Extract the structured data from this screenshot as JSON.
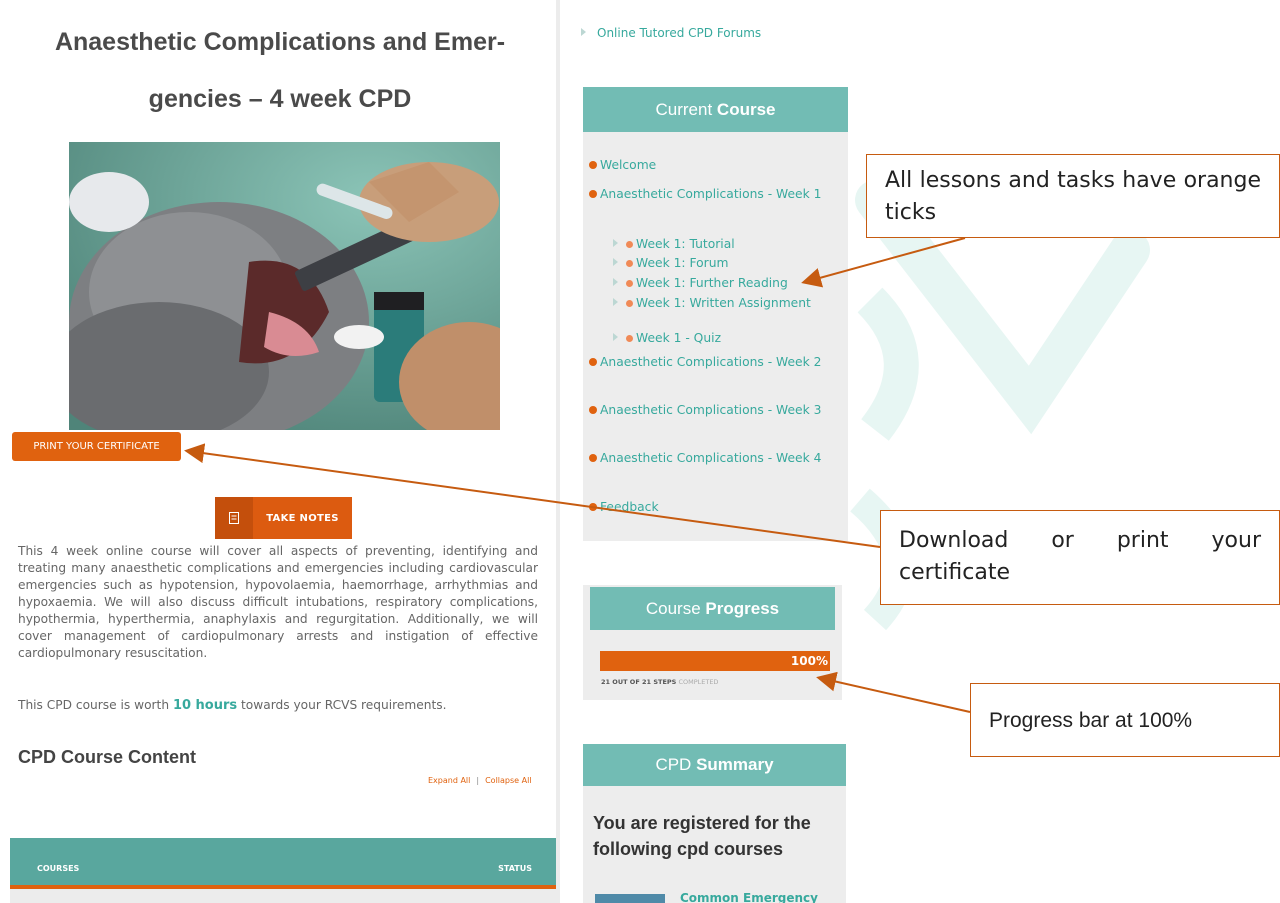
{
  "course": {
    "title_line1": "Anaesthetic Complications and Emer-",
    "title_line2": "gencies – 4 week CPD",
    "print_certificate": "PRINT YOUR CERTIFICATE",
    "take_notes": "TAKE NOTES",
    "description": "This 4 week online course will cover all aspects of preventing, identifying and treating many anaesthetic complications and emergencies including cardiovascular emergencies such as hypotension, hypovolaemia, haemorrhage, arrhythmias and hypoxaemia.  We will also discuss difficult intubations, respiratory complications, hypothermia, hyperthermia, anaphylaxis and regurgitation.  Additionally, we will cover management of cardiopulmonary arrests and instigation of effective cardiopulmonary resuscitation.",
    "worth_prefix": "This CPD course is worth ",
    "worth_hours": "10 hours",
    "worth_suffix": " towards your RCVS requirements.",
    "content_heading": "CPD Course Content",
    "expand_all": "Expand All",
    "separator": "|",
    "collapse_all": "Collapse All",
    "table_col_courses": "COURSES",
    "table_col_status": "STATUS"
  },
  "sidebar": {
    "top_link": "Online Tutored CPD Forums",
    "current_course": {
      "heading_light": "Current ",
      "heading_bold": "Course",
      "items": [
        {
          "label": "Welcome"
        },
        {
          "label": "Anaesthetic Complications - Week 1"
        },
        {
          "label": "Anaesthetic Complications - Week 2"
        },
        {
          "label": "Anaesthetic Complications - Week 3"
        },
        {
          "label": "Anaesthetic Complications - Week 4"
        },
        {
          "label": "Feedback"
        }
      ],
      "subitems": [
        {
          "label": "Week 1: Tutorial"
        },
        {
          "label": "Week 1: Forum"
        },
        {
          "label": "Week 1: Further Reading"
        },
        {
          "label": "Week 1: Written Assignment"
        },
        {
          "label": "Week 1 - Quiz"
        }
      ]
    },
    "progress": {
      "heading_light": "Course ",
      "heading_bold": "Progress",
      "percent": 100,
      "percent_label": "100%",
      "steps_bold": "21 OUT OF 21 STEPS",
      "steps_light": "COMPLETED"
    },
    "summary": {
      "heading_light": "CPD ",
      "heading_bold": "Summary",
      "registered_text": "You are registered for the following cpd courses",
      "partial_course_link": "Common Emergency"
    }
  },
  "callouts": {
    "ticks": "All lessons and tasks have orange ticks",
    "certificate": "Download or print your certificate",
    "progress": "Progress bar at 100%"
  },
  "colors": {
    "accent_orange": "#e0620f",
    "teal": "#72bcb4",
    "teal_dark": "#59a79e",
    "link_teal": "#37a99d"
  }
}
